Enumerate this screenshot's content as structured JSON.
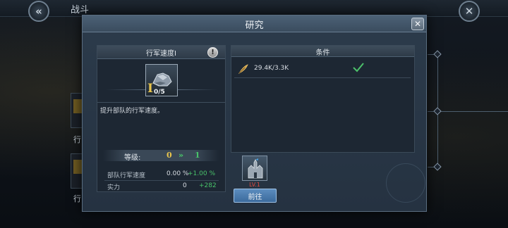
{
  "topbar": {
    "title": "战斗"
  },
  "background": {
    "left_label_1": "行",
    "left_label_2": "行"
  },
  "dialog": {
    "title": "研究",
    "close_label": "✕"
  },
  "tech": {
    "name": "行军速度I",
    "info_label": "!",
    "roman_numeral": "I",
    "progress": "0/5",
    "description": "提升部队的行军速度。",
    "level": {
      "label": "等级:",
      "current": "0",
      "arrow": "»",
      "next": "1"
    },
    "stats": [
      {
        "label": "部队行军速度",
        "current": "0.00 %",
        "next": "+1.00 %"
      },
      {
        "label": "实力",
        "current": "0",
        "next": "+282"
      }
    ]
  },
  "conditions": {
    "header": "条件",
    "items": [
      {
        "icon": "feather-icon",
        "amount": "29.4K/3.3K",
        "met": true
      }
    ]
  },
  "building": {
    "level_label": "LV.1",
    "goto_label": "前往"
  },
  "colors": {
    "accent_gold": "#e8c44c",
    "accent_green": "#49c26a",
    "button_blue": "#4a7bb0",
    "level_red": "#e04a3f"
  }
}
